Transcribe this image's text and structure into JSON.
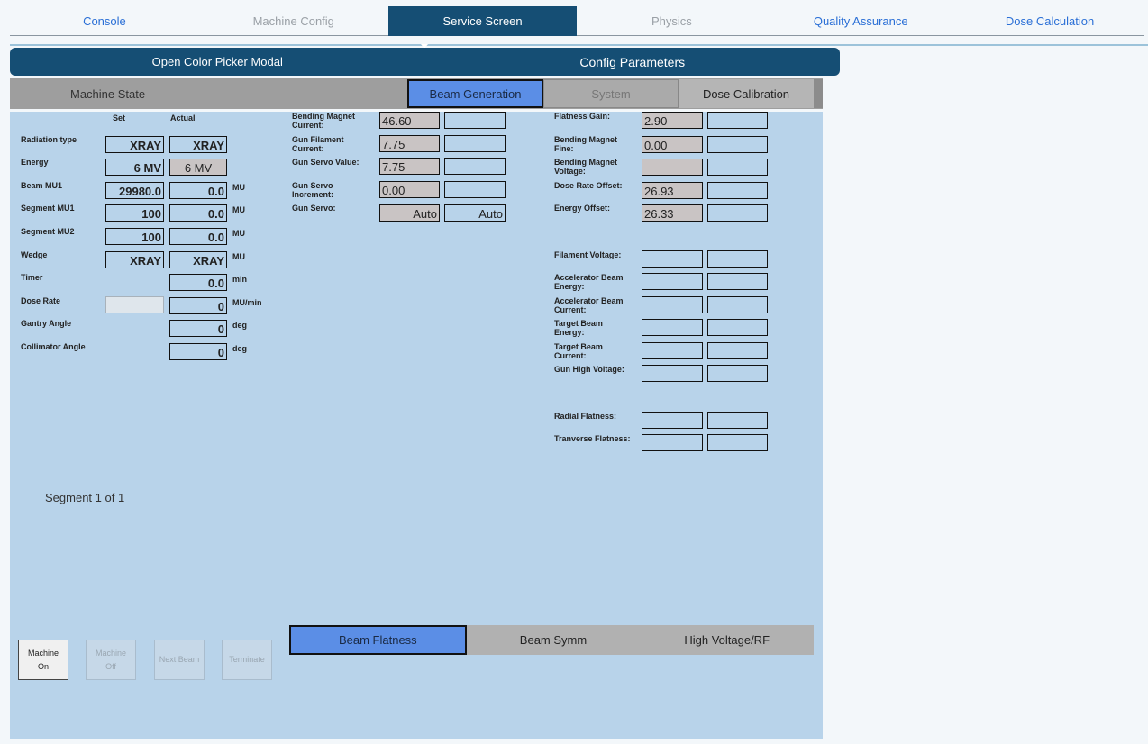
{
  "nav": {
    "tabs": [
      "Console",
      "Machine Config",
      "Service Screen",
      "Physics",
      "Quality Assurance",
      "Dose Calculation"
    ]
  },
  "bar": {
    "color_picker": "Open Color Picker Modal",
    "config_params": "Config Parameters"
  },
  "state": {
    "machine_state": "Machine State",
    "tabs": [
      "Beam Generation",
      "System",
      "Dose Calibration"
    ]
  },
  "treatment": {
    "set_header": "Set",
    "actual_header": "Actual",
    "rows": [
      {
        "label": "Radiation type",
        "set": "XRAY",
        "actual": "XRAY",
        "unit": ""
      },
      {
        "label": "Energy",
        "set": "6 MV",
        "actual": "6 MV",
        "unit": ""
      },
      {
        "label": "Beam MU1",
        "set": "29980.0",
        "actual": "0.0",
        "unit": "MU"
      },
      {
        "label": "Segment MU1",
        "set": "100",
        "actual": "0.0",
        "unit": "MU"
      },
      {
        "label": "Segment MU2",
        "set": "100",
        "actual": "0.0",
        "unit": "MU"
      },
      {
        "label": "Wedge",
        "set": "XRAY",
        "actual": "XRAY",
        "unit": "MU"
      },
      {
        "label": "Timer",
        "set": "",
        "actual": "0.0",
        "unit": "min"
      },
      {
        "label": "Dose Rate",
        "set": "",
        "actual": "0",
        "unit": "MU/min"
      },
      {
        "label": "Gantry Angle",
        "set": "",
        "actual": "0",
        "unit": "deg"
      },
      {
        "label": "Collimator Angle",
        "set": "",
        "actual": "0",
        "unit": "deg"
      }
    ]
  },
  "beam_params": [
    {
      "label1": "Bending Magnet",
      "label2": "Current:",
      "value": "46.60",
      "actual": ""
    },
    {
      "label1": "Gun Filament",
      "label2": "Current:",
      "value": "7.75",
      "actual": ""
    },
    {
      "label1": "Gun Servo Value:",
      "label2": "",
      "value": "7.75",
      "actual": ""
    },
    {
      "label1": "Gun Servo",
      "label2": "Increment:",
      "value": "0.00",
      "actual": ""
    },
    {
      "label1": "Gun Servo:",
      "label2": "",
      "value": "Auto",
      "actual": "Auto"
    }
  ],
  "right_params": [
    {
      "label1": "Flatness Gain:",
      "label2": "",
      "value": "2.90",
      "actual": ""
    },
    {
      "label1": "Bending Magnet",
      "label2": "Fine:",
      "value": "0.00",
      "actual": ""
    },
    {
      "label1": "Bending Magnet",
      "label2": "Voltage:",
      "value": "",
      "actual": ""
    },
    {
      "label1": "Dose Rate Offset:",
      "label2": "",
      "value": "26.93",
      "actual": ""
    },
    {
      "label1": "Energy Offset:",
      "label2": "",
      "value": "26.33",
      "actual": ""
    },
    {
      "label1": "Filament Voltage:",
      "label2": "",
      "value": "",
      "actual": ""
    },
    {
      "label1": "Accelerator Beam",
      "label2": "Energy:",
      "value": "",
      "actual": ""
    },
    {
      "label1": "Accelerator Beam",
      "label2": "Current:",
      "value": "",
      "actual": ""
    },
    {
      "label1": "Target Beam",
      "label2": "Energy:",
      "value": "",
      "actual": ""
    },
    {
      "label1": "Target Beam",
      "label2": "Current:",
      "value": "",
      "actual": ""
    },
    {
      "label1": "Gun High Voltage:",
      "label2": "",
      "value": "",
      "actual": ""
    },
    {
      "label1": "Radial Flatness:",
      "label2": "",
      "value": "",
      "actual": ""
    },
    {
      "label1": "Tranverse Flatness:",
      "label2": "",
      "value": "",
      "actual": ""
    }
  ],
  "segment": "Segment 1 of 1",
  "controls": {
    "machine_on_1": "Machine",
    "machine_on_2": "On",
    "machine_off_1": "Machine",
    "machine_off_2": "Off",
    "next_beam": "Next Beam",
    "terminate": "Terminate"
  },
  "beam_tabs": [
    "Beam Flatness",
    "Beam Symm",
    "High Voltage/RF"
  ],
  "colors": {
    "navy": "#154e74",
    "panel": "#b8d3ea",
    "active_tab": "#5b8ee6",
    "link": "#2a6fd6"
  }
}
